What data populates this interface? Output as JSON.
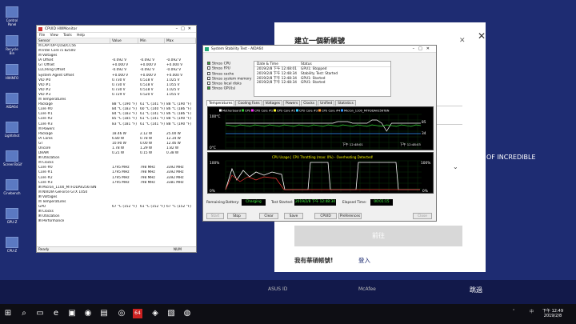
{
  "setup": {
    "title": "建立一個新帳號",
    "close": "✕",
    "close2": "✕",
    "tagline": "OF INCREDIBLE",
    "dropdown_chev": "⌄",
    "next_button": "前往",
    "have_account": "我有華碩帳號!",
    "login": "登入",
    "footer_left": "ASUS ID",
    "footer_mid": "McAfee",
    "footer_next": "跳過"
  },
  "desktop_icons": [
    {
      "label": "Control Panel"
    },
    {
      "label": "Recycle Bin"
    },
    {
      "label": "HWiNFO"
    },
    {
      "label": "AIDA64"
    },
    {
      "label": "Lightshot"
    },
    {
      "label": "ScreenToGif"
    },
    {
      "label": "Cinebench"
    },
    {
      "label": "GPU-Z"
    },
    {
      "label": "CPU-Z"
    }
  ],
  "hwmonitor": {
    "title": "CPUID HWMonitor",
    "controls": "–□✕",
    "menu": [
      "File",
      "View",
      "Tools",
      "Help"
    ],
    "columns": [
      "Sensor",
      "Value",
      "Min",
      "Max"
    ],
    "rows": [
      [
        "⊟ LAPTOP-Q1SDCC56",
        "",
        "",
        ""
      ],
      [
        "  ⊟ Intel Core i5 8250U",
        "",
        "",
        ""
      ],
      [
        "    ⊟ Voltages",
        "",
        "",
        ""
      ],
      [
        "       IA Offset",
        "-0.092 V",
        "-0.092 V",
        "-0.092 V"
      ],
      [
        "       GT Offset",
        "+0.000 V",
        "+0.000 V",
        "+0.000 V"
      ],
      [
        "       LLC/Ring Offset",
        "-0.092 V",
        "-0.092 V",
        "-0.092 V"
      ],
      [
        "       System Agent Offset",
        "+0.000 V",
        "+0.000 V",
        "+0.000 V"
      ],
      [
        "       VID #0",
        "0.730 V",
        "0.518 V",
        "1.025 V"
      ],
      [
        "       VID #1",
        "0.730 V",
        "0.518 V",
        "1.055 V"
      ],
      [
        "       VID #2",
        "0.730 V",
        "0.518 V",
        "1.025 V"
      ],
      [
        "       VID #3",
        "0.729 V",
        "0.520 V",
        "1.055 V"
      ],
      [
        "    ⊟ Temperatures",
        "",
        "",
        ""
      ],
      [
        "       Package",
        "88 °C (190 °F)",
        "61 °C (141 °F)",
        "88 °C (190 °F)"
      ],
      [
        "       Core #0",
        "84 °C (183 °F)",
        "60 °C (140 °F)",
        "86 °C (186 °F)"
      ],
      [
        "       Core #1",
        "84 °C (183 °F)",
        "61 °C (141 °F)",
        "86 °C (186 °F)"
      ],
      [
        "       Core #2",
        "85 °C (185 °F)",
        "61 °C (141 °F)",
        "88 °C (190 °F)"
      ],
      [
        "       Core #3",
        "83 °C (181 °F)",
        "61 °C (141 °F)",
        "88 °C (190 °F)"
      ],
      [
        "    ⊟ Powers",
        "",
        "",
        ""
      ],
      [
        "       Package",
        "18.46 W",
        "2.12 W",
        "25.00 W"
      ],
      [
        "       IA Cores",
        "6.80 W",
        "0.78 W",
        "12.34 W"
      ],
      [
        "       GT",
        "10.90 W",
        "0.00 W",
        "12.46 W"
      ],
      [
        "       Uncore",
        "1.78 W",
        "1.29 W",
        "1.82 W"
      ],
      [
        "       DRAM",
        "0.21 W",
        "0.15 W",
        "0.38 W"
      ],
      [
        "    ⊞ Utilization",
        "",
        "",
        ""
      ],
      [
        "    ⊟ Clocks",
        "",
        "",
        ""
      ],
      [
        "       Core #0",
        "1795 MHz",
        "798 MHz",
        "3392 MHz"
      ],
      [
        "       Core #1",
        "1795 MHz",
        "798 MHz",
        "3392 MHz"
      ],
      [
        "       Core #2",
        "1795 MHz",
        "798 MHz",
        "3392 MHz"
      ],
      [
        "       Core #3",
        "1795 MHz",
        "798 MHz",
        "3381 MHz"
      ],
      [
        "  ⊞ Micron_1100_MTFDDAV256TBN",
        "",
        "",
        ""
      ],
      [
        "  ⊟ NVIDIA GeForce GTX 1050",
        "",
        "",
        ""
      ],
      [
        "    ⊞ Voltages",
        "",
        "",
        ""
      ],
      [
        "    ⊟ Temperatures",
        "",
        "",
        ""
      ],
      [
        "       GPU",
        "67 °C (152 °F)",
        "61 °C (152 °F)",
        "67 °C (152 °F)"
      ],
      [
        "    ⊞ Clocks",
        "",
        "",
        ""
      ],
      [
        "    ⊞ Utilization",
        "",
        "",
        ""
      ],
      [
        "    ⊞ Performance",
        "",
        "",
        ""
      ]
    ],
    "status": "Ready",
    "status_right": "NUM"
  },
  "aida": {
    "title": "System Stability Test - AIDA64",
    "controls": "–□✕",
    "checks": [
      {
        "label": "Stress CPU",
        "on": true
      },
      {
        "label": "Stress FPU",
        "on": false
      },
      {
        "label": "Stress cache",
        "on": false
      },
      {
        "label": "Stress system memory",
        "on": false
      },
      {
        "label": "Stress local disks",
        "on": false
      },
      {
        "label": "Stress GPU(s)",
        "on": true
      }
    ],
    "log_head": [
      "Date & Time",
      "Status"
    ],
    "log": [
      [
        "2019/2/8 下午 12:48:01",
        "GPU1: Stopped"
      ],
      [
        "2019/2/8 下午 12:48:34",
        "Stability Test: Started"
      ],
      [
        "2019/2/8 下午 12:48:34",
        "GPU1: Started"
      ],
      [
        "2019/2/8 下午 12:48:34",
        "GPU1: Started"
      ]
    ],
    "tabs": [
      "Temperatures",
      "Cooling Fans",
      "Voltages",
      "Powers",
      "Clocks",
      "Unified",
      "Statistics"
    ],
    "graph1": {
      "legend": [
        "Motherboard",
        "CPU",
        "CPU Core #1",
        "CPU Core #2",
        "CPU Core #3",
        "CPU Core #4",
        "Micron_1100_MTFDDAV256TBN"
      ],
      "y_top": "100°C",
      "y_bottom": "0°C",
      "right_a": "85",
      "right_b": "34",
      "time_a": "下午 12:48:01",
      "time_b": "下午 12:48:03"
    },
    "graph2": {
      "title": "CPU Usage  |  CPU Throttling (max: 0%) - Overheating Detected!",
      "y_top": "100%",
      "y_bottom": "0%",
      "right_top": "100%",
      "right_bottom": "0%"
    },
    "status_row": {
      "battery_label": "Remaining Battery:",
      "battery_value": "Charging",
      "started_label": "Test Started:",
      "started_value": "2019/2/8 下午 12:48:34",
      "elapsed_label": "Elapsed Time:",
      "elapsed_value": "00:01:15"
    },
    "buttons": [
      "Start",
      "Stop",
      "Clear",
      "Save",
      "CPUID",
      "Preferences",
      "Close"
    ]
  },
  "taskbar": {
    "time": "下午 12:49",
    "date": "2019/2/8",
    "lang": "中",
    "up_arrow": "⌃",
    "icons": [
      {
        "glyph": "⊞"
      },
      {
        "glyph": "⌕"
      },
      {
        "glyph": "▭"
      },
      {
        "glyph": "e"
      },
      {
        "glyph": "▣"
      },
      {
        "glyph": "◉"
      },
      {
        "glyph": "▤"
      },
      {
        "glyph": "◎"
      },
      {
        "glyph": "64"
      },
      {
        "glyph": "◈"
      },
      {
        "glyph": "▧"
      },
      {
        "glyph": "◍"
      }
    ]
  }
}
